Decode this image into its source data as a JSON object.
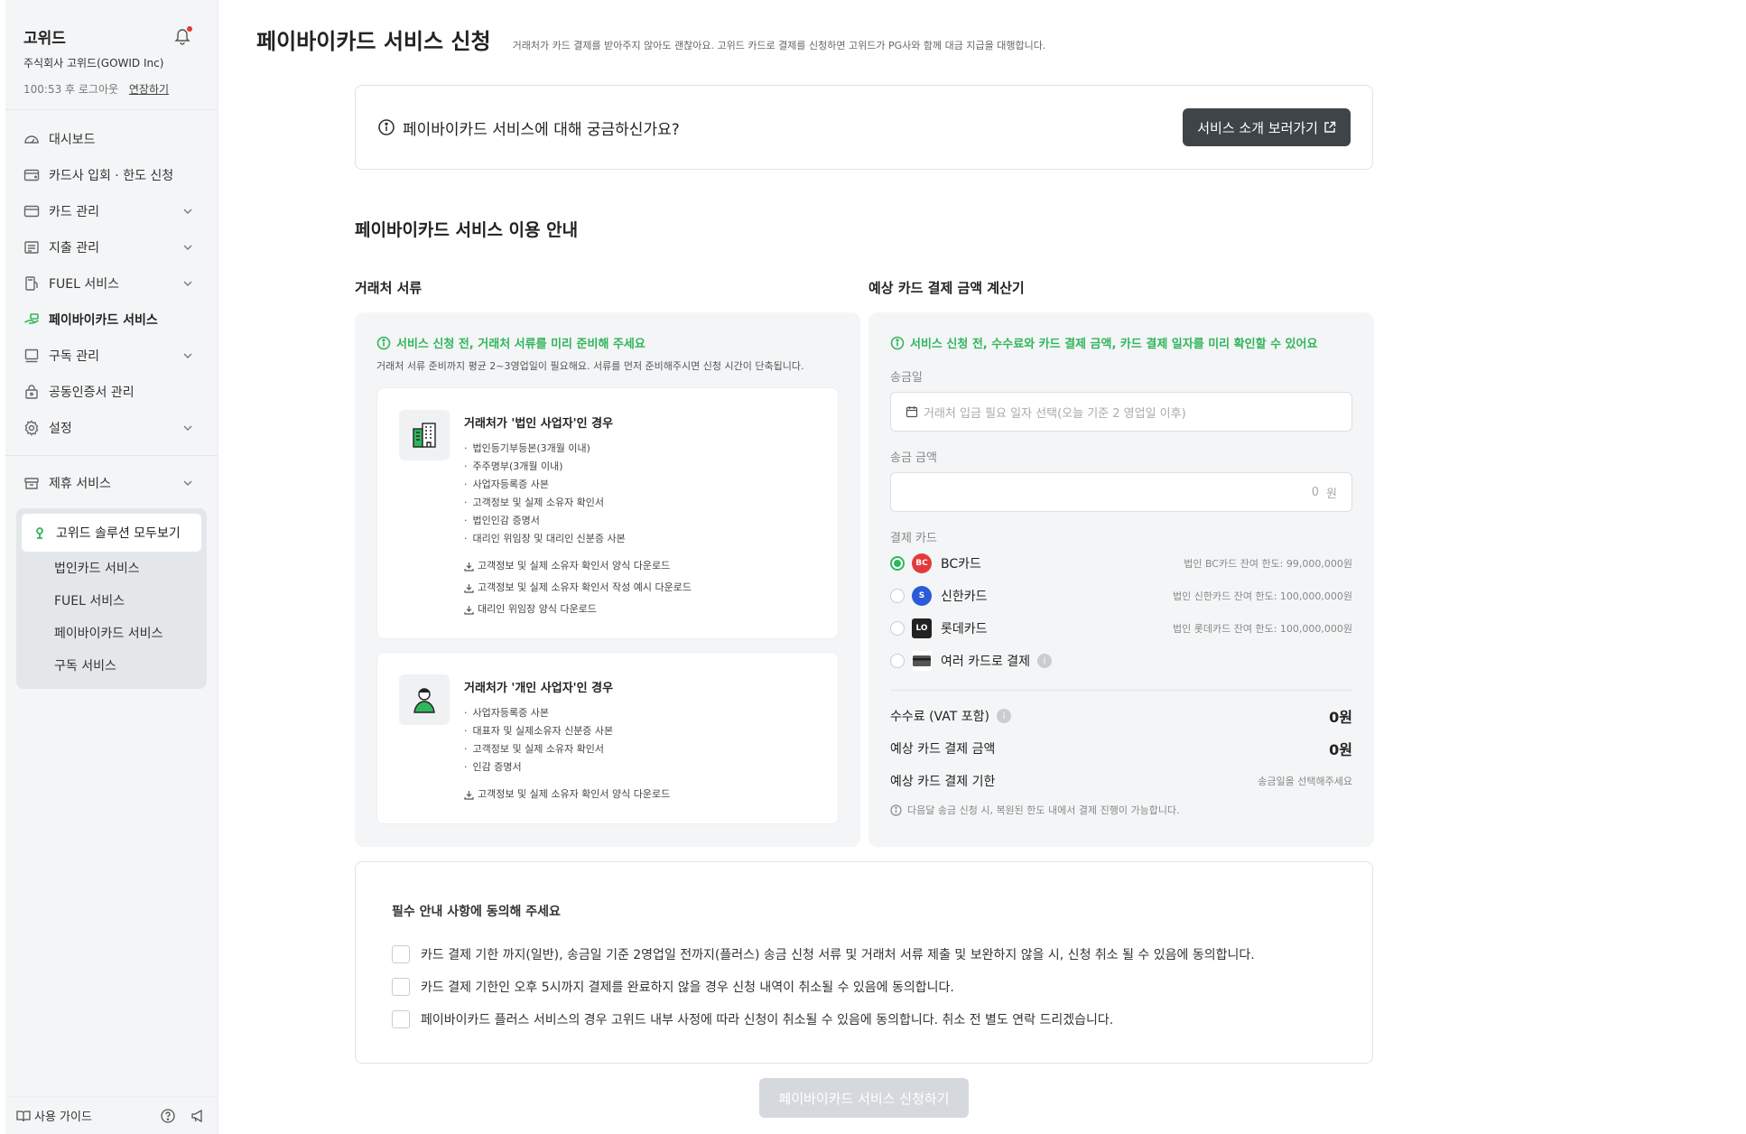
{
  "sidebar": {
    "company": "고위드",
    "legal_name": "주식회사 고위드(GOWID Inc)",
    "session": "100:53 후 로그아웃",
    "extend": "연장하기",
    "nav": [
      {
        "label": "대시보드",
        "icon": "dashboard-icon",
        "chevron": false
      },
      {
        "label": "카드사 입회 · 한도 신청",
        "icon": "card-apply-icon",
        "chevron": false
      },
      {
        "label": "카드 관리",
        "icon": "card-icon",
        "chevron": true
      },
      {
        "label": "지출 관리",
        "icon": "receipt-icon",
        "chevron": true
      },
      {
        "label": "FUEL 서비스",
        "icon": "fuel-icon",
        "chevron": true
      },
      {
        "label": "페이바이카드 서비스",
        "icon": "pay-hand-icon",
        "chevron": false,
        "active": true
      },
      {
        "label": "구독 관리",
        "icon": "subscription-icon",
        "chevron": true
      },
      {
        "label": "공동인증서 관리",
        "icon": "certificate-icon",
        "chevron": false
      },
      {
        "label": "설정",
        "icon": "gear-icon",
        "chevron": true
      }
    ],
    "partner": {
      "label": "제휴 서비스",
      "icon": "partner-icon"
    },
    "solutions": {
      "head": "고위드 솔루션 모두보기",
      "items": [
        "법인카드 서비스",
        "FUEL 서비스",
        "페이바이카드 서비스",
        "구독 서비스"
      ]
    },
    "footer": {
      "guide": "사용 가이드"
    }
  },
  "header": {
    "title": "페이바이카드 서비스 신청",
    "desc": "거래처가 카드 결제를 받아주지 않아도 괜찮아요. 고위드 카드로 결제를 신청하면 고위드가 PG사와 함께 대금 지급을 대행합니다."
  },
  "info": {
    "question": "페이바이카드 서비스에 대해 궁금하신가요?",
    "button": "서비스 소개 보러가기"
  },
  "section_title": "페이바이카드 서비스 이용 안내",
  "docs": {
    "title": "거래처 서류",
    "note": "서비스 신청 전, 거래처 서류를 미리 준비해 주세요",
    "sub": "거래처 서류 준비까지 평균 2~3영업일이 필요해요. 서류를 먼저 준비해주시면 신청 시간이 단축됩니다.",
    "corp": {
      "title": "거래처가 '법인 사업자'인 경우",
      "items": [
        "법인등기부등본(3개월 이내)",
        "주주명부(3개월 이내)",
        "사업자등록증 사본",
        "고객정보 및 실제 소유자 확인서",
        "법인인감 증명서",
        "대리인 위임장 및 대리인 신분증 사본"
      ],
      "links": [
        "고객정보 및 실제 소유자 확인서 양식 다운로드",
        "고객정보 및 실제 소유자 확인서 작성 예시 다운로드",
        "대리인 위임장 양식 다운로드"
      ]
    },
    "indiv": {
      "title": "거래처가 '개인 사업자'인 경우",
      "items": [
        "사업자등록증 사본",
        "대표자 및 실제소유자 신분증 사본",
        "고객정보 및 실제 소유자 확인서",
        "인감 증명서"
      ],
      "links": [
        "고객정보 및 실제 소유자 확인서 양식 다운로드"
      ]
    }
  },
  "calc": {
    "title": "예상 카드 결제 금액 계산기",
    "note": "서비스 신청 전, 수수료와 카드 결제 금액, 카드 결제 일자를 미리 확인할 수 있어요",
    "date_label": "송금일",
    "date_placeholder": "거래처 입금 필요 일자 선택(오늘 기준 2 영업일 이후)",
    "amount_label": "송금 금액",
    "amount_value": "0",
    "amount_unit": "원",
    "card_label": "결제 카드",
    "cards": [
      {
        "name": "BC카드",
        "limit": "법인 BC카드 잔여 한도: 99,000,000원",
        "color": "#e53a3a",
        "selected": true,
        "icon": "bc-card-logo-icon"
      },
      {
        "name": "신한카드",
        "limit": "법인 신한카드 잔여 한도: 100,000,000원",
        "color": "#2c5bd8",
        "selected": false,
        "icon": "shinhan-card-logo-icon"
      },
      {
        "name": "롯데카드",
        "limit": "법인 롯데카드 잔여 한도: 100,000,000원",
        "color": "#222222",
        "selected": false,
        "icon": "lotte-card-logo-icon"
      },
      {
        "name": "여러 카드로 결제",
        "limit": "",
        "color": "#555555",
        "selected": false,
        "icon": "multi-card-icon"
      }
    ],
    "fee_label": "수수료 (VAT 포함)",
    "fee_value": "0원",
    "amount_total_label": "예상 카드 결제 금액",
    "amount_total_value": "0원",
    "deadline_label": "예상 카드 결제 기한",
    "deadline_value": "송금일을 선택해주세요",
    "foot": "다음달 송금 신청 시, 복원된 한도 내에서 결제 진행이 가능합니다."
  },
  "agree": {
    "title": "필수 안내 사항에 동의해 주세요",
    "items": [
      "카드 결제 기한 까지(일반), 송금일 기준 2영업일 전까지(플러스) 송금 신청 서류 및 거래처 서류 제출 및 보완하지 않을 시, 신청 취소 될 수 있음에 동의합니다.",
      "카드 결제 기한인 오후 5시까지 결제를 완료하지 않을 경우 신청 내역이 취소될 수 있음에 동의합니다.",
      "페이바이카드 플러스 서비스의 경우 고위드 내부 사정에 따라 신청이 취소될 수 있음에 동의합니다. 취소 전 별도 연락 드리겠습니다."
    ]
  },
  "submit": "페이바이카드 서비스 신청하기",
  "colors": {
    "accent": "#2fb65c",
    "dark_button": "#3f4448",
    "disabled_button": "#d5d8dc"
  }
}
